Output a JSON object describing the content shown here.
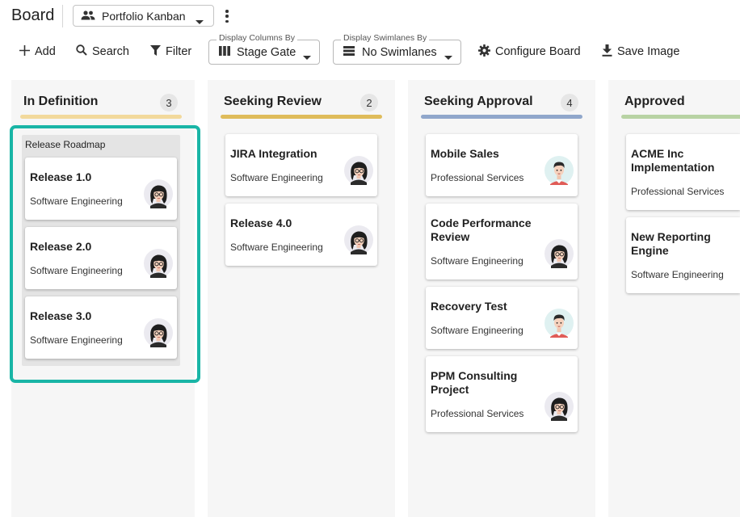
{
  "header": {
    "title": "Board",
    "board_select": "Portfolio Kanban"
  },
  "toolbar": {
    "add": "Add",
    "search": "Search",
    "filter": "Filter",
    "columns_label": "Display Columns By",
    "columns_value": "Stage Gate",
    "swimlanes_label": "Display Swimlanes By",
    "swimlanes_value": "No Swimlanes",
    "configure": "Configure Board",
    "save_image": "Save Image"
  },
  "columns": [
    {
      "name": "In Definition",
      "count": "3",
      "color": "#f2d99c",
      "group": "Release Roadmap",
      "cards": [
        {
          "title": "Release 1.0",
          "sub": "Software Engineering",
          "avatar": "female-avatar"
        },
        {
          "title": "Release 2.0",
          "sub": "Software Engineering",
          "avatar": "female-avatar"
        },
        {
          "title": "Release 3.0",
          "sub": "Software Engineering",
          "avatar": "female-avatar"
        }
      ]
    },
    {
      "name": "Seeking Review",
      "count": "2",
      "color": "#dfbc5b",
      "cards": [
        {
          "title": "JIRA Integration",
          "sub": "Software Engineering",
          "avatar": "female-avatar"
        },
        {
          "title": "Release 4.0",
          "sub": "Software Engineering",
          "avatar": "female-avatar"
        }
      ]
    },
    {
      "name": "Seeking Approval",
      "count": "4",
      "color": "#90a7cb",
      "cards": [
        {
          "title": "Mobile Sales",
          "sub": "Professional Services",
          "avatar": "male-avatar"
        },
        {
          "title": "Code Performance Review",
          "sub": "Software Engineering",
          "avatar": "female-avatar"
        },
        {
          "title": "Recovery Test",
          "sub": "Software Engineering",
          "avatar": "male-avatar"
        },
        {
          "title": "PPM Consulting Project",
          "sub": "Professional Services",
          "avatar": "female-avatar"
        }
      ]
    },
    {
      "name": "Approved",
      "color": "#b8d3a4",
      "cards": [
        {
          "title": "ACME Inc Implementation",
          "sub": "Professional Services"
        },
        {
          "title": "New Reporting Engine",
          "sub": "Software Engineering"
        }
      ]
    }
  ]
}
